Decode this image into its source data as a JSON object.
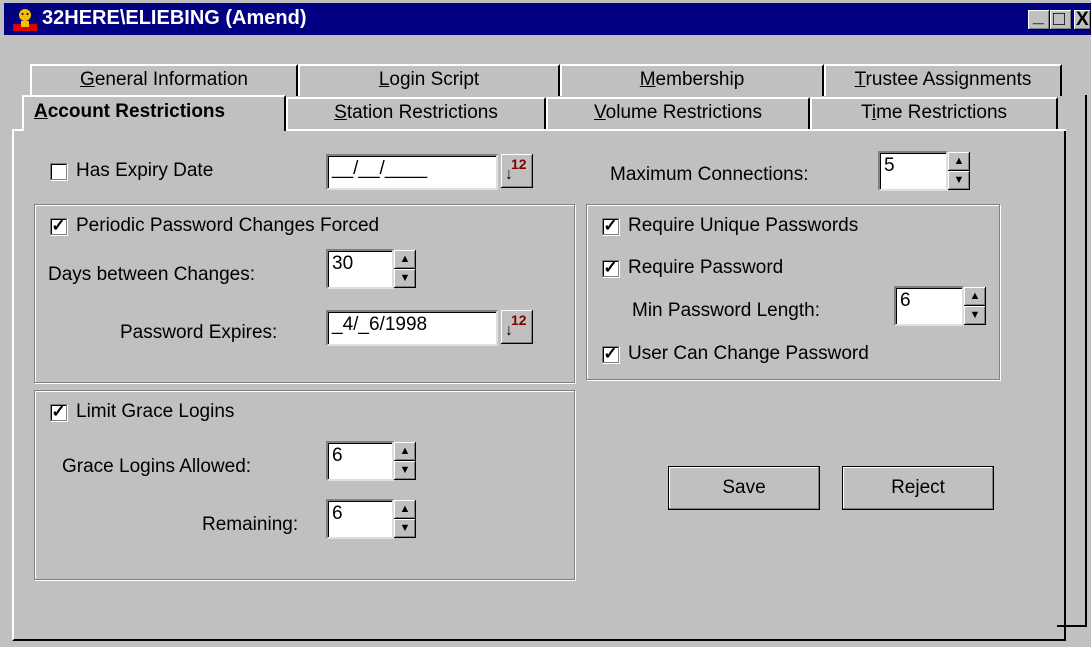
{
  "window": {
    "title": "32HERE\\ELIEBING (Amend)",
    "titlebar_color": "#000080",
    "face_color": "#c0c0c0",
    "min_glyph": "_",
    "max_glyph": "□",
    "close_glyph": "X"
  },
  "tabs": {
    "back_row": [
      {
        "label": "General Information",
        "accel": "G"
      },
      {
        "label": "Login Script",
        "accel": "L"
      },
      {
        "label": "Membership",
        "accel": "M"
      },
      {
        "label": "Trustee Assignments",
        "accel": "T"
      }
    ],
    "front_row": [
      {
        "label": "Account Restrictions",
        "accel": "A",
        "selected": true
      },
      {
        "label": "Station Restrictions",
        "accel": "S"
      },
      {
        "label": "Volume Restrictions",
        "accel": "V"
      },
      {
        "label": "Time Restrictions",
        "accel": "i"
      }
    ]
  },
  "expiry": {
    "has_expiry_label": "Has Expiry Date",
    "has_expiry_checked": false,
    "date_value": "__/__/____",
    "calendar_glyph": "12"
  },
  "max_connections": {
    "label": "Maximum Connections:",
    "value": "5"
  },
  "password_changes": {
    "forced_label": "Periodic Password Changes Forced",
    "forced_checked": true,
    "days_label": "Days between Changes:",
    "days_value": "30",
    "expires_label": "Password Expires:",
    "expires_value": "_4/_6/1998",
    "calendar_glyph": "12"
  },
  "password_rules": {
    "unique_label": "Require Unique Passwords",
    "unique_checked": true,
    "require_label": "Require Password",
    "require_checked": true,
    "min_length_label": "Min Password Length:",
    "min_length_value": "6",
    "user_change_label": "User Can Change Password",
    "user_change_checked": true
  },
  "grace": {
    "limit_label": "Limit Grace Logins",
    "limit_checked": true,
    "allowed_label": "Grace Logins Allowed:",
    "allowed_value": "6",
    "remaining_label": "Remaining:",
    "remaining_value": "6"
  },
  "buttons": {
    "save": "Save",
    "reject": "Reject"
  },
  "check_glyph": "✓",
  "spin_up_glyph": "▲",
  "spin_down_glyph": "▼"
}
